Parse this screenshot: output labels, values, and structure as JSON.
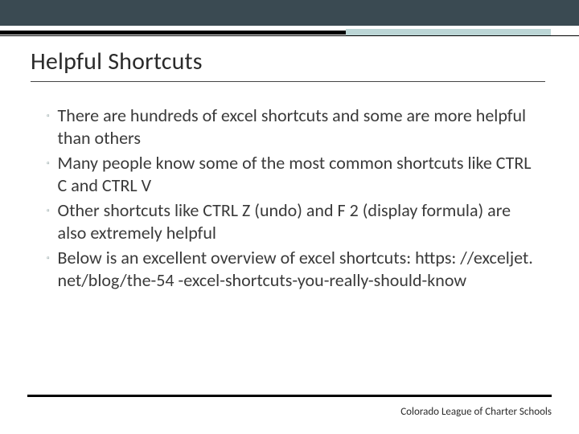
{
  "slide": {
    "title": "Helpful Shortcuts",
    "bullets": [
      "There are hundreds of excel shortcuts and some are more helpful than others",
      "Many people know some of the most common shortcuts like CTRL C and CTRL V",
      "Other shortcuts like CTRL Z (undo) and F 2 (display formula) are also extremely helpful",
      "Below is an excellent overview of excel shortcuts: https: //exceljet. net/blog/the-54 -excel-shortcuts-you-really-should-know"
    ],
    "footer": "Colorado League of Charter Schools"
  }
}
